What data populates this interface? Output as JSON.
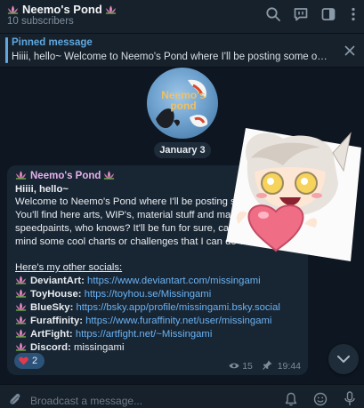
{
  "header": {
    "title": "Neemo's Pond",
    "subscribers": "10 subscribers"
  },
  "pinned": {
    "label": "Pinned message",
    "text": "Hiiii, hello~ Welcome to Neemo's Pond where I'll be posting some of my st..."
  },
  "avatar": {
    "text_line1": "Neemo's",
    "text_line2": "pond"
  },
  "date": "January 3",
  "message": {
    "author": "Neemo's Pond",
    "greeting": "Hiiii, hello~",
    "lines": [
      "Welcome to Neemo's Pond where I'll be posting so",
      "You'll find here arts, WIP's, material stuff and may",
      "speedpaints, who knows? It'll be fun for sure, cau",
      "mind some cool charts or challenges that I can do v"
    ],
    "socials_heading": "Here's my other socials:",
    "socials": [
      {
        "name": "DeviantArt:",
        "value": "https://www.deviantart.com/missingami",
        "is_link": true
      },
      {
        "name": "ToyHouse:",
        "value": "https://toyhou.se/Missingami",
        "is_link": true
      },
      {
        "name": "BlueSky:",
        "value": "https://bsky.app/profile/missingami.bsky.social",
        "is_link": true
      },
      {
        "name": "Furaffinity:",
        "value": "https://www.furaffinity.net/user/missingami",
        "is_link": true
      },
      {
        "name": "ArtFight:",
        "value": "https://artfight.net/~Missingami",
        "is_link": true
      },
      {
        "name": "Discord:",
        "value": "missingami",
        "is_link": false
      }
    ],
    "reaction": {
      "emoji": "heart",
      "count": "2"
    },
    "views": "15",
    "time": "19:44"
  },
  "input": {
    "placeholder": "Broadcast a message..."
  },
  "icons": {
    "search": "search-icon",
    "comments": "comments-icon",
    "sidebar": "sidebar-toggle-icon",
    "more": "more-vertical-icon",
    "close": "close-icon",
    "attach": "paperclip-icon",
    "notify": "bell-icon",
    "emoji": "emoji-icon",
    "mic": "microphone-icon",
    "scroll": "chevron-down-icon",
    "views": "eye-icon",
    "pin": "pin-icon"
  },
  "colors": {
    "background": "#0e1621",
    "panel": "#17212b",
    "bubble": "#182533",
    "accent": "#5fa8e0",
    "link": "#6ab3f3",
    "author": "#e5b0ea"
  }
}
